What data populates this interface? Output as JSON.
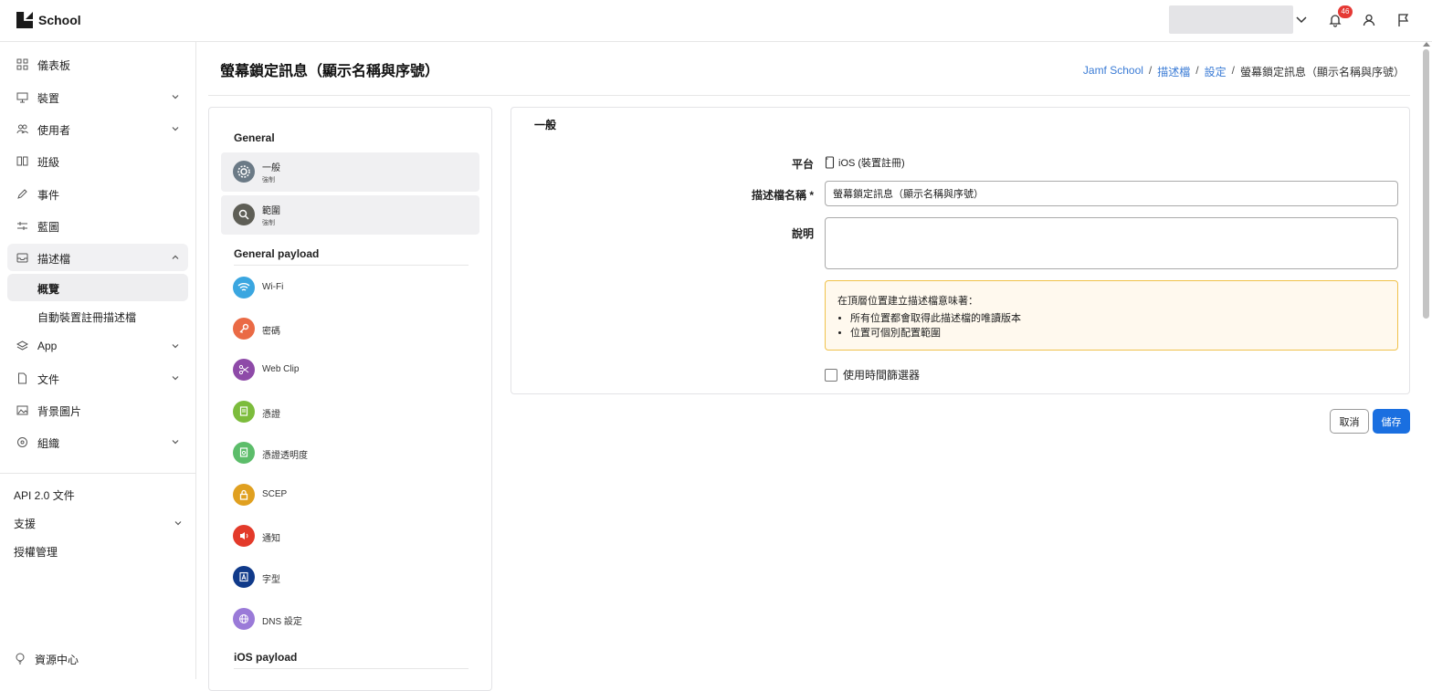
{
  "app": {
    "name": "School"
  },
  "header": {
    "notification_count": "46"
  },
  "sidebar": {
    "items": [
      {
        "label": "儀表板"
      },
      {
        "label": "裝置"
      },
      {
        "label": "使用者"
      },
      {
        "label": "班級"
      },
      {
        "label": "事件"
      },
      {
        "label": "藍圖"
      },
      {
        "label": "描述檔"
      },
      {
        "label": "App"
      },
      {
        "label": "文件"
      },
      {
        "label": "背景圖片"
      },
      {
        "label": "組織"
      }
    ],
    "profiles_sub": [
      {
        "label": "概覽"
      },
      {
        "label": "自動裝置註冊描述檔"
      }
    ],
    "bottom_links": [
      {
        "label": "API 2.0 文件"
      },
      {
        "label": "支援"
      },
      {
        "label": "授權管理"
      }
    ],
    "resource_center": "資源中心"
  },
  "page": {
    "title": "螢幕鎖定訊息（顯示名稱與序號）",
    "breadcrumb": [
      "Jamf School",
      "描述檔",
      "設定",
      "螢幕鎖定訊息（顯示名稱與序號）"
    ]
  },
  "payloads": {
    "general_title": "General",
    "general_items": [
      {
        "name": "一般",
        "sub": "強制"
      },
      {
        "name": "範圍",
        "sub": "強制"
      }
    ],
    "general_payload_title": "General payload",
    "general_payload_items": [
      {
        "name": "Wi-Fi"
      },
      {
        "name": "密碼"
      },
      {
        "name": "Web Clip"
      },
      {
        "name": "憑證"
      },
      {
        "name": "憑證透明度"
      },
      {
        "name": "SCEP"
      },
      {
        "name": "通知"
      },
      {
        "name": "字型"
      },
      {
        "name": "DNS 設定"
      }
    ],
    "ios_payload_title": "iOS payload"
  },
  "form": {
    "section_title": "一般",
    "platform_label": "平台",
    "platform_value": "iOS (裝置註冊)",
    "name_label": "描述檔名稱 *",
    "name_value": "螢幕鎖定訊息（顯示名稱與序號）",
    "description_label": "說明",
    "description_value": "",
    "notice": {
      "intro": "在頂層位置建立描述檔意味著：",
      "bullets": [
        "所有位置都會取得此描述檔的唯讀版本",
        "位置可個別配置範圍"
      ]
    },
    "time_filter_label": "使用時間篩選器"
  },
  "actions": {
    "cancel": "取消",
    "save": "儲存"
  },
  "colors": {
    "accent": "#1a6fe0",
    "link": "#3a7bd5",
    "warning_border": "#f0c24b",
    "badge": "#e53935"
  }
}
